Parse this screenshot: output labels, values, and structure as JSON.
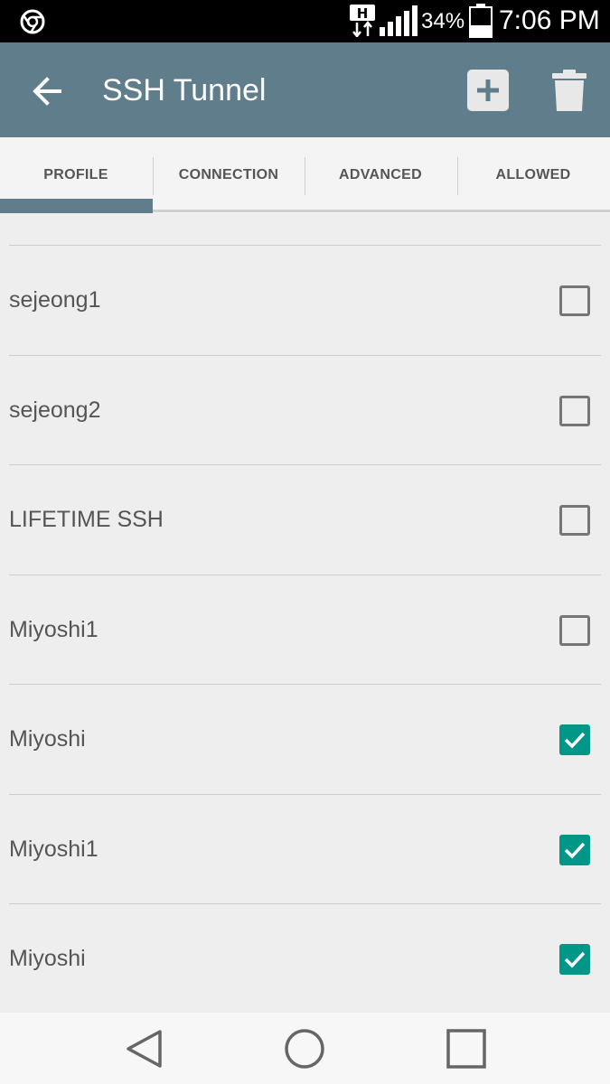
{
  "status_bar": {
    "battery_percent": "34%",
    "time": "7:06 PM",
    "network_type": "H",
    "icons": [
      "chrome-icon",
      "h-data-icon",
      "signal-icon",
      "battery-icon"
    ]
  },
  "app_bar": {
    "title": "SSH Tunnel",
    "color": "#607d8b",
    "icons": [
      "back-arrow-icon",
      "add-icon",
      "trash-icon"
    ]
  },
  "tabs": [
    {
      "label": "PROFILE",
      "selected": true
    },
    {
      "label": "CONNECTION",
      "selected": false
    },
    {
      "label": "ADVANCED",
      "selected": false
    },
    {
      "label": "ALLOWED",
      "selected": false
    }
  ],
  "profiles": [
    {
      "name": "sejeong1",
      "checked": false
    },
    {
      "name": "sejeong2",
      "checked": false
    },
    {
      "name": "LIFETIME SSH",
      "checked": false
    },
    {
      "name": "Miyoshi1",
      "checked": false
    },
    {
      "name": "Miyoshi",
      "checked": true
    },
    {
      "name": "Miyoshi1",
      "checked": true
    },
    {
      "name": "Miyoshi",
      "checked": true
    }
  ],
  "accent_color": "#009688",
  "nav_bar": {
    "icons": [
      "nav-back-icon",
      "nav-home-icon",
      "nav-recents-icon"
    ]
  }
}
